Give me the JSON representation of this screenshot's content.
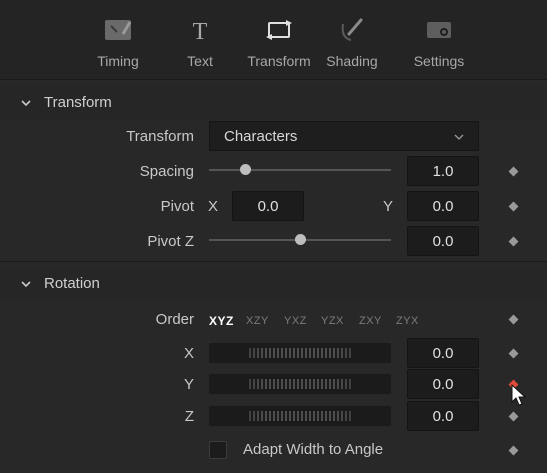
{
  "tabs": [
    {
      "label": "Timing",
      "icon": "timing-icon",
      "active": false
    },
    {
      "label": "Text",
      "icon": "text-icon",
      "active": false
    },
    {
      "label": "Transform",
      "icon": "transform-icon",
      "active": true
    },
    {
      "label": "Shading",
      "icon": "shading-icon",
      "active": false
    },
    {
      "label": "Settings",
      "icon": "settings-icon",
      "active": false
    }
  ],
  "transform_section": {
    "title": "Transform",
    "transform_label": "Transform",
    "transform_value": "Characters",
    "spacing_label": "Spacing",
    "spacing_value": "1.0",
    "spacing_slider": 0.2,
    "pivot_label": "Pivot",
    "pivot_x_label": "X",
    "pivot_x_value": "0.0",
    "pivot_y_label": "Y",
    "pivot_y_value": "0.0",
    "pivot_z_label": "Pivot Z",
    "pivot_z_value": "0.0",
    "pivot_z_slider": 0.5
  },
  "rotation_section": {
    "title": "Rotation",
    "order_label": "Order",
    "order_options": [
      "XYZ",
      "XZY",
      "YXZ",
      "YZX",
      "ZXY",
      "ZYX"
    ],
    "order_selected": "XYZ",
    "x_label": "X",
    "x_value": "0.0",
    "y_label": "Y",
    "y_value": "0.0",
    "z_label": "Z",
    "z_value": "0.0",
    "adapt_label": "Adapt Width to Angle",
    "adapt_checked": false
  },
  "colors": {
    "accent": "#d83a3a",
    "keyframe_active": "#e04a3a"
  }
}
